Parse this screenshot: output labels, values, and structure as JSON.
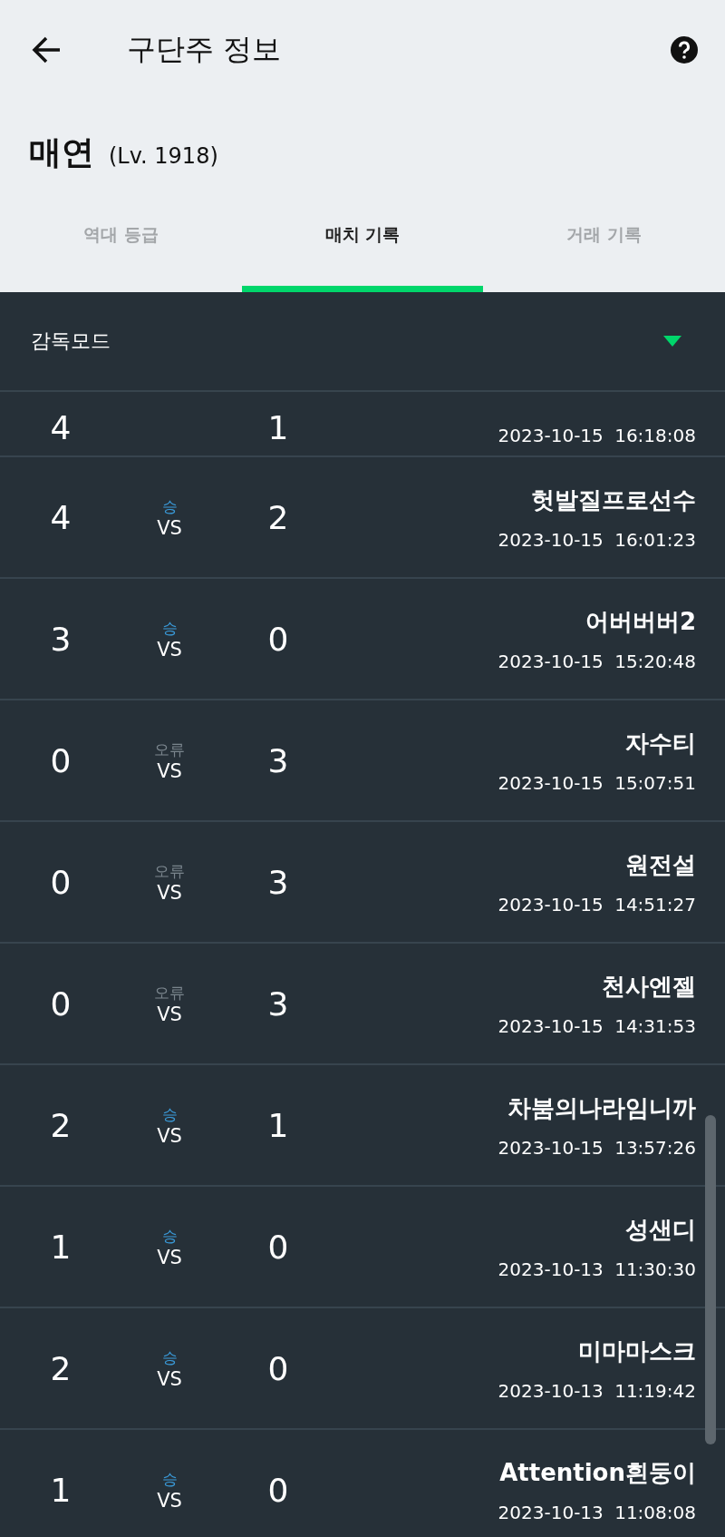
{
  "top_bar": {
    "title": "구단주 정보"
  },
  "owner": {
    "name": "매연",
    "level": "(Lv. 1918)"
  },
  "tabs": [
    {
      "label": "역대 등급",
      "selected": false
    },
    {
      "label": "매치 기록",
      "selected": true
    },
    {
      "label": "거래 기록",
      "selected": false
    }
  ],
  "mode_dropdown": {
    "value": "감독모드"
  },
  "matches": [
    {
      "kind": "partial",
      "score_home": "4",
      "score_away": "1",
      "date": "2023-10-15",
      "time": "16:18:08"
    },
    {
      "kind": "full",
      "score_home": "4",
      "result": "승",
      "color": "#3a9ad9",
      "vs": "VS",
      "score_away": "2",
      "opponent": "헛발질프로선수",
      "date": "2023-10-15",
      "time": "16:01:23"
    },
    {
      "kind": "full",
      "score_home": "3",
      "result": "승",
      "color": "#3a9ad9",
      "vs": "VS",
      "score_away": "0",
      "opponent": "어버버버2",
      "date": "2023-10-15",
      "time": "15:20:48"
    },
    {
      "kind": "full",
      "score_home": "0",
      "result": "오류",
      "color": "#7a858d",
      "vs": "VS",
      "score_away": "3",
      "opponent": "자수티",
      "date": "2023-10-15",
      "time": "15:07:51"
    },
    {
      "kind": "full",
      "score_home": "0",
      "result": "오류",
      "color": "#7a858d",
      "vs": "VS",
      "score_away": "3",
      "opponent": "원전설",
      "date": "2023-10-15",
      "time": "14:51:27"
    },
    {
      "kind": "full",
      "score_home": "0",
      "result": "오류",
      "color": "#7a858d",
      "vs": "VS",
      "score_away": "3",
      "opponent": "천사엔젤",
      "date": "2023-10-15",
      "time": "14:31:53"
    },
    {
      "kind": "full",
      "score_home": "2",
      "result": "승",
      "color": "#3a9ad9",
      "vs": "VS",
      "score_away": "1",
      "opponent": "차붐의나라임니까",
      "date": "2023-10-15",
      "time": "13:57:26"
    },
    {
      "kind": "full",
      "score_home": "1",
      "result": "승",
      "color": "#3a9ad9",
      "vs": "VS",
      "score_away": "0",
      "opponent": "성샌디",
      "date": "2023-10-13",
      "time": "11:30:30"
    },
    {
      "kind": "full",
      "score_home": "2",
      "result": "승",
      "color": "#3a9ad9",
      "vs": "VS",
      "score_away": "0",
      "opponent": "미마마스크",
      "date": "2023-10-13",
      "time": "11:19:42"
    },
    {
      "kind": "full",
      "score_home": "1",
      "result": "승",
      "color": "#3a9ad9",
      "vs": "VS",
      "score_away": "0",
      "opponent": "Attention흰둥이",
      "date": "2023-10-13",
      "time": "11:08:08"
    }
  ]
}
